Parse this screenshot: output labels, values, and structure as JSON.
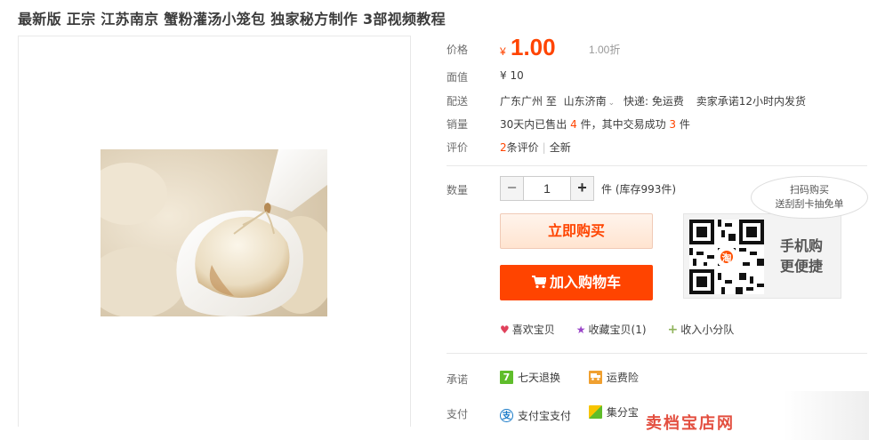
{
  "title": "最新版 正宗 江苏南京 蟹粉灌汤小笼包 独家秘方制作 3部视频教程",
  "price": {
    "label": "价格",
    "currency": "¥",
    "value": "1.00",
    "discount": "1.00折"
  },
  "face_value": {
    "label": "面值",
    "value": "¥ 10"
  },
  "delivery": {
    "label": "配送",
    "from": "广东广州 至",
    "to": "山东济南",
    "express": "快递: 免运费",
    "promise": "卖家承诺12小时内发货"
  },
  "sales": {
    "label": "销量",
    "prefix": "30天内已售出",
    "sold": "4",
    "mid": "件，其中交易成功",
    "success": "3",
    "suffix": "件"
  },
  "reviews": {
    "label": "评价",
    "count": "2",
    "count_text": "条评价",
    "all": "全新"
  },
  "quantity": {
    "label": "数量",
    "minus": "−",
    "plus": "+",
    "value": "1",
    "stock": "件 (库存993件)"
  },
  "buttons": {
    "buy": "立即购买",
    "cart": "加入购物车"
  },
  "qr": {
    "badge_text": "淘",
    "line1": "手机购",
    "line2": "更便捷",
    "bubble_line1": "扫码购买",
    "bubble_line2": "送刮刮卡抽免单"
  },
  "actions": {
    "like": "喜欢宝贝",
    "favorite": "收藏宝贝(1)",
    "team": "收入小分队"
  },
  "promise": {
    "label": "承诺",
    "return_badge": "7",
    "return_text": "七天退换",
    "insurance_text": "运费险"
  },
  "payment": {
    "label": "支付",
    "alipay_text": "支付宝支付",
    "jifen_text": "集分宝"
  },
  "watermark": "卖档宝店网",
  "colors": {
    "accent": "#ff4400",
    "heart": "#e0415b",
    "star": "#9a45c8",
    "plus_green": "#8fb35b",
    "return_green": "#5fbd2b",
    "insurance_orange": "#f0a030"
  }
}
